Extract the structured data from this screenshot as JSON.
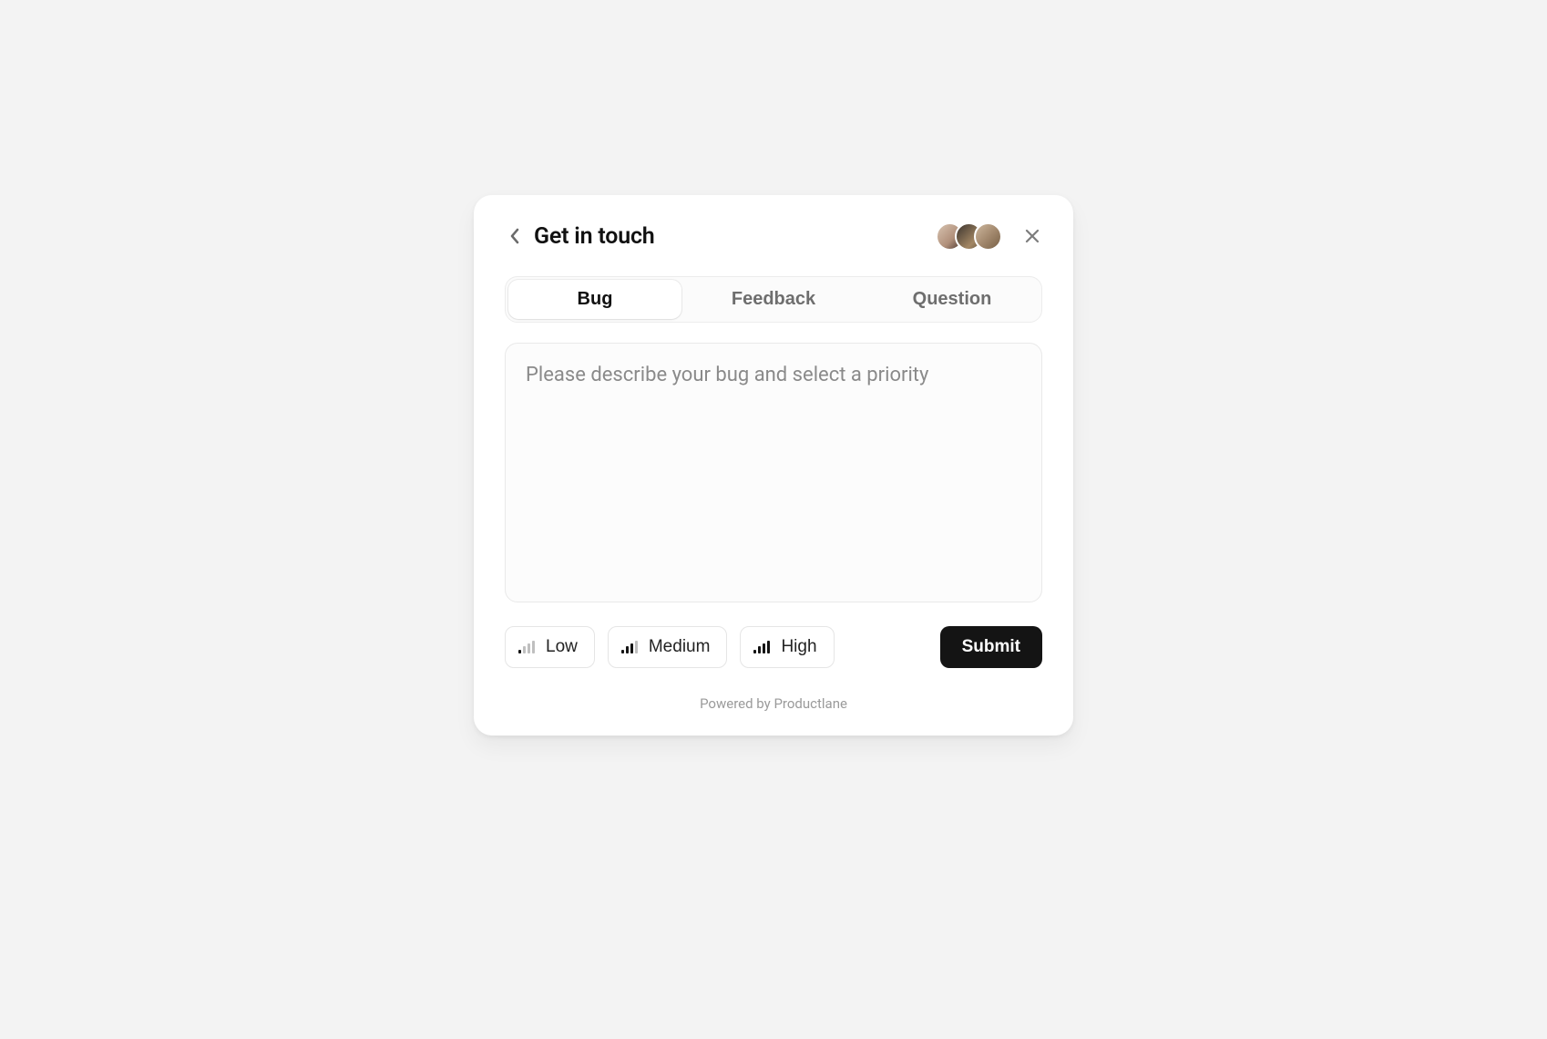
{
  "header": {
    "title": "Get in touch"
  },
  "tabs": {
    "bug": "Bug",
    "feedback": "Feedback",
    "question": "Question",
    "active": "bug"
  },
  "textarea": {
    "placeholder": "Please describe your bug and select a priority",
    "value": ""
  },
  "priority": {
    "low": "Low",
    "medium": "Medium",
    "high": "High"
  },
  "submit_label": "Submit",
  "powered_by": "Powered by Productlane"
}
